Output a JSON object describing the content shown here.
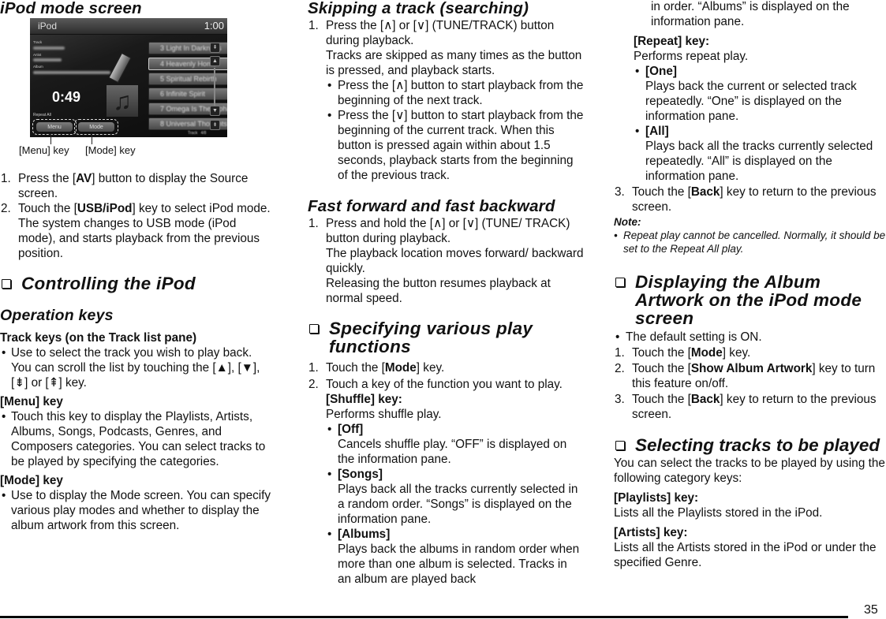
{
  "col1": {
    "figure_title": "iPod mode screen",
    "screen": {
      "title": "iPod",
      "clock": "1:00",
      "labels": {
        "track": "Track",
        "artist": "Artist",
        "album": "Album"
      },
      "elapsed": "0:49",
      "repeat_status": "Repeat All",
      "tracks": [
        {
          "num": "3",
          "name": "Light In Darkness"
        },
        {
          "num": "4",
          "name": "Heavenly Home",
          "selected": true
        },
        {
          "num": "5",
          "name": "Spiritual Rebirth"
        },
        {
          "num": "6",
          "name": "Infinite Spirit"
        },
        {
          "num": "7",
          "name": "Omega Is The Alpha"
        },
        {
          "num": "8",
          "name": "Universal Thoughts"
        }
      ],
      "track_counter_label": "Track",
      "track_counter": "4/8",
      "menu_key": "Menu",
      "mode_key": "Mode",
      "scroll_icons": [
        "page-up-icon",
        "up-icon",
        "down-icon",
        "page-down-icon"
      ]
    },
    "captions": {
      "menu": "[Menu] key",
      "mode": "[Mode] key"
    },
    "steps": [
      {
        "num": "1.",
        "pre": "Press the [",
        "bold": "AV",
        "post": "] button to display the Source screen."
      },
      {
        "num": "2.",
        "pre": "Touch the [",
        "bold": "USB/iPod",
        "post": "] key to select iPod mode."
      }
    ],
    "step2_detail": "The system changes to USB mode (iPod mode), and starts playback from the previous position.",
    "section_controlling": "Controlling the iPod",
    "operation_keys": "Operation keys",
    "track_keys_head": "Track keys (on the Track list pane)",
    "track_keys_text_a": "Use to select the track you wish to play back. You can scroll the list by touching the",
    "track_keys_text_b": "[▲], [▼], [⇟] or [⇞] key.",
    "menu_key_head": "[Menu] key",
    "menu_key_text": "Touch this key to display the Playlists, Artists, Albums, Songs, Podcasts, Genres, and Composers categories. You can select tracks to be played by specifying the categories.",
    "mode_key_head": "[Mode] key",
    "mode_key_text": "Use to display the Mode screen. You can specify various play modes and whether to display the album artwork from this screen."
  },
  "col2": {
    "skipping_title": "Skipping a track (searching)",
    "skip_step": {
      "num": "1.",
      "text": "Press the [∧] or [∨] (TUNE/TRACK) button during playback."
    },
    "skip_detail": "Tracks are skipped as many times as the button is pressed, and playback starts.",
    "skip_bullets": [
      "Press the [∧] button to start playback from the beginning of the next track.",
      "Press the [∨] button to start playback from the beginning of the current track. When this button is pressed again within about 1.5 seconds, playback starts from the beginning of the previous track."
    ],
    "ff_title": "Fast forward and fast backward",
    "ff_step": {
      "num": "1.",
      "text": "Press and hold the [∧] or [∨] (TUNE/ TRACK) button during playback."
    },
    "ff_detail_1": "The playback location moves forward/ backward quickly.",
    "ff_detail_2": "Releasing the button resumes playback at normal speed.",
    "section_specifying": "Specifying various play functions",
    "spec_step1": {
      "num": "1.",
      "pre": "Touch the [",
      "bold": "Mode",
      "post": "] key."
    },
    "spec_step2": {
      "num": "2.",
      "text": "Touch a key of the function you want to play."
    },
    "shuffle_head": "[Shuffle] key:",
    "shuffle_text": "Performs shuffle play.",
    "shuffle_options": [
      {
        "label": "[Off]",
        "text": "Cancels shuffle play. “OFF” is displayed on the information pane."
      },
      {
        "label": "[Songs]",
        "text": "Plays back all the tracks currently selected in a random order. “Songs” is displayed on the information pane."
      },
      {
        "label": "[Albums]",
        "text": "Plays back the albums in random order when more than one album is selected. Tracks in an album are played back"
      }
    ]
  },
  "col3": {
    "albums_cont": "in order. “Albums” is displayed on the information pane.",
    "repeat_head": "[Repeat] key:",
    "repeat_text": "Performs repeat play.",
    "repeat_options": [
      {
        "label": "[One]",
        "text": "Plays back the current or selected track repeatedly. “One” is displayed on the information pane."
      },
      {
        "label": "[All]",
        "text": "Plays back all the tracks currently selected repeatedly. “All” is displayed on the information pane."
      }
    ],
    "step3": {
      "num": "3.",
      "pre": "Touch the [",
      "bold": "Back",
      "post": "] key to return to the previous screen."
    },
    "note_head": "Note:",
    "note_text": "Repeat play cannot be cancelled. Normally, it should be set to the Repeat All play.",
    "section_artwork": "Displaying the Album Artwork on the iPod mode screen",
    "artwork_default": "The default setting is ON.",
    "artwork_steps": [
      {
        "num": "1.",
        "pre": "Touch the [",
        "bold": "Mode",
        "post": "] key."
      },
      {
        "num": "2.",
        "pre": "Touch the [",
        "bold": "Show Album Artwork",
        "post": "] key to turn this feature on/off."
      },
      {
        "num": "3.",
        "pre": "Touch the [",
        "bold": "Back",
        "post": "] key to return to the previous screen."
      }
    ],
    "section_selecting": "Selecting tracks to be played",
    "selecting_text": "You can select the tracks to be played by using the following category keys:",
    "playlists_head": "[Playlists] key:",
    "playlists_text": "Lists all the Playlists stored in the iPod.",
    "artists_head": "[Artists] key:",
    "artists_text": "Lists all the Artists stored in the iPod or under the specified Genre."
  },
  "page_number": "35"
}
